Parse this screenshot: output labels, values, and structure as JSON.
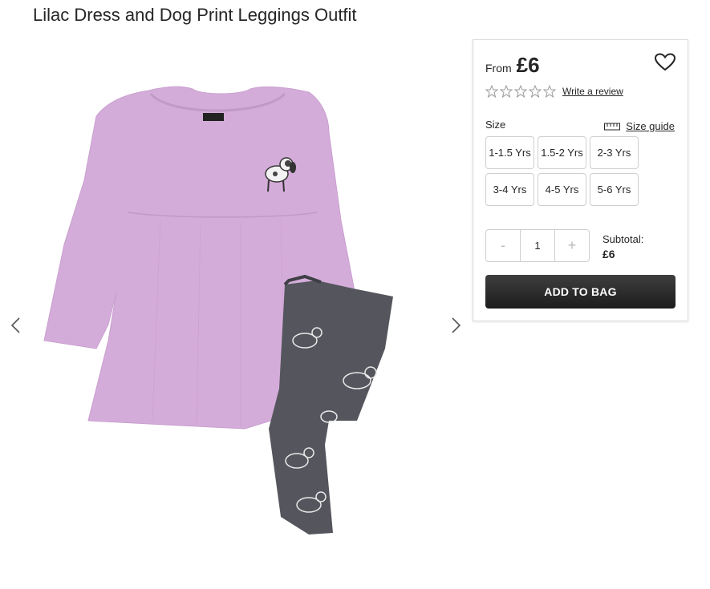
{
  "product": {
    "title": "Lilac Dress and Dog Print Leggings Outfit"
  },
  "carousel": {
    "prev_icon": "chevron-left-icon",
    "next_icon": "chevron-right-icon"
  },
  "panel": {
    "price_prefix": "From",
    "price": "£6",
    "wishlist_icon": "heart-icon",
    "rating": {
      "stars_filled": 0,
      "stars_total": 5,
      "review_link": "Write a review"
    },
    "size": {
      "label": "Size",
      "guide_label": "Size guide",
      "guide_icon": "ruler-icon",
      "options": [
        "1-1.5 Yrs",
        "1.5-2 Yrs",
        "2-3 Yrs",
        "3-4 Yrs",
        "4-5 Yrs",
        "5-6 Yrs"
      ]
    },
    "quantity": {
      "minus": "-",
      "value": "1",
      "plus": "+"
    },
    "subtotal": {
      "label": "Subtotal:",
      "value": "£6"
    },
    "add_to_bag": "ADD TO BAG"
  },
  "colors": {
    "dress": "#d6aedb",
    "leggings": "#55565d",
    "button": "#262626",
    "border": "#dcdcdc"
  }
}
